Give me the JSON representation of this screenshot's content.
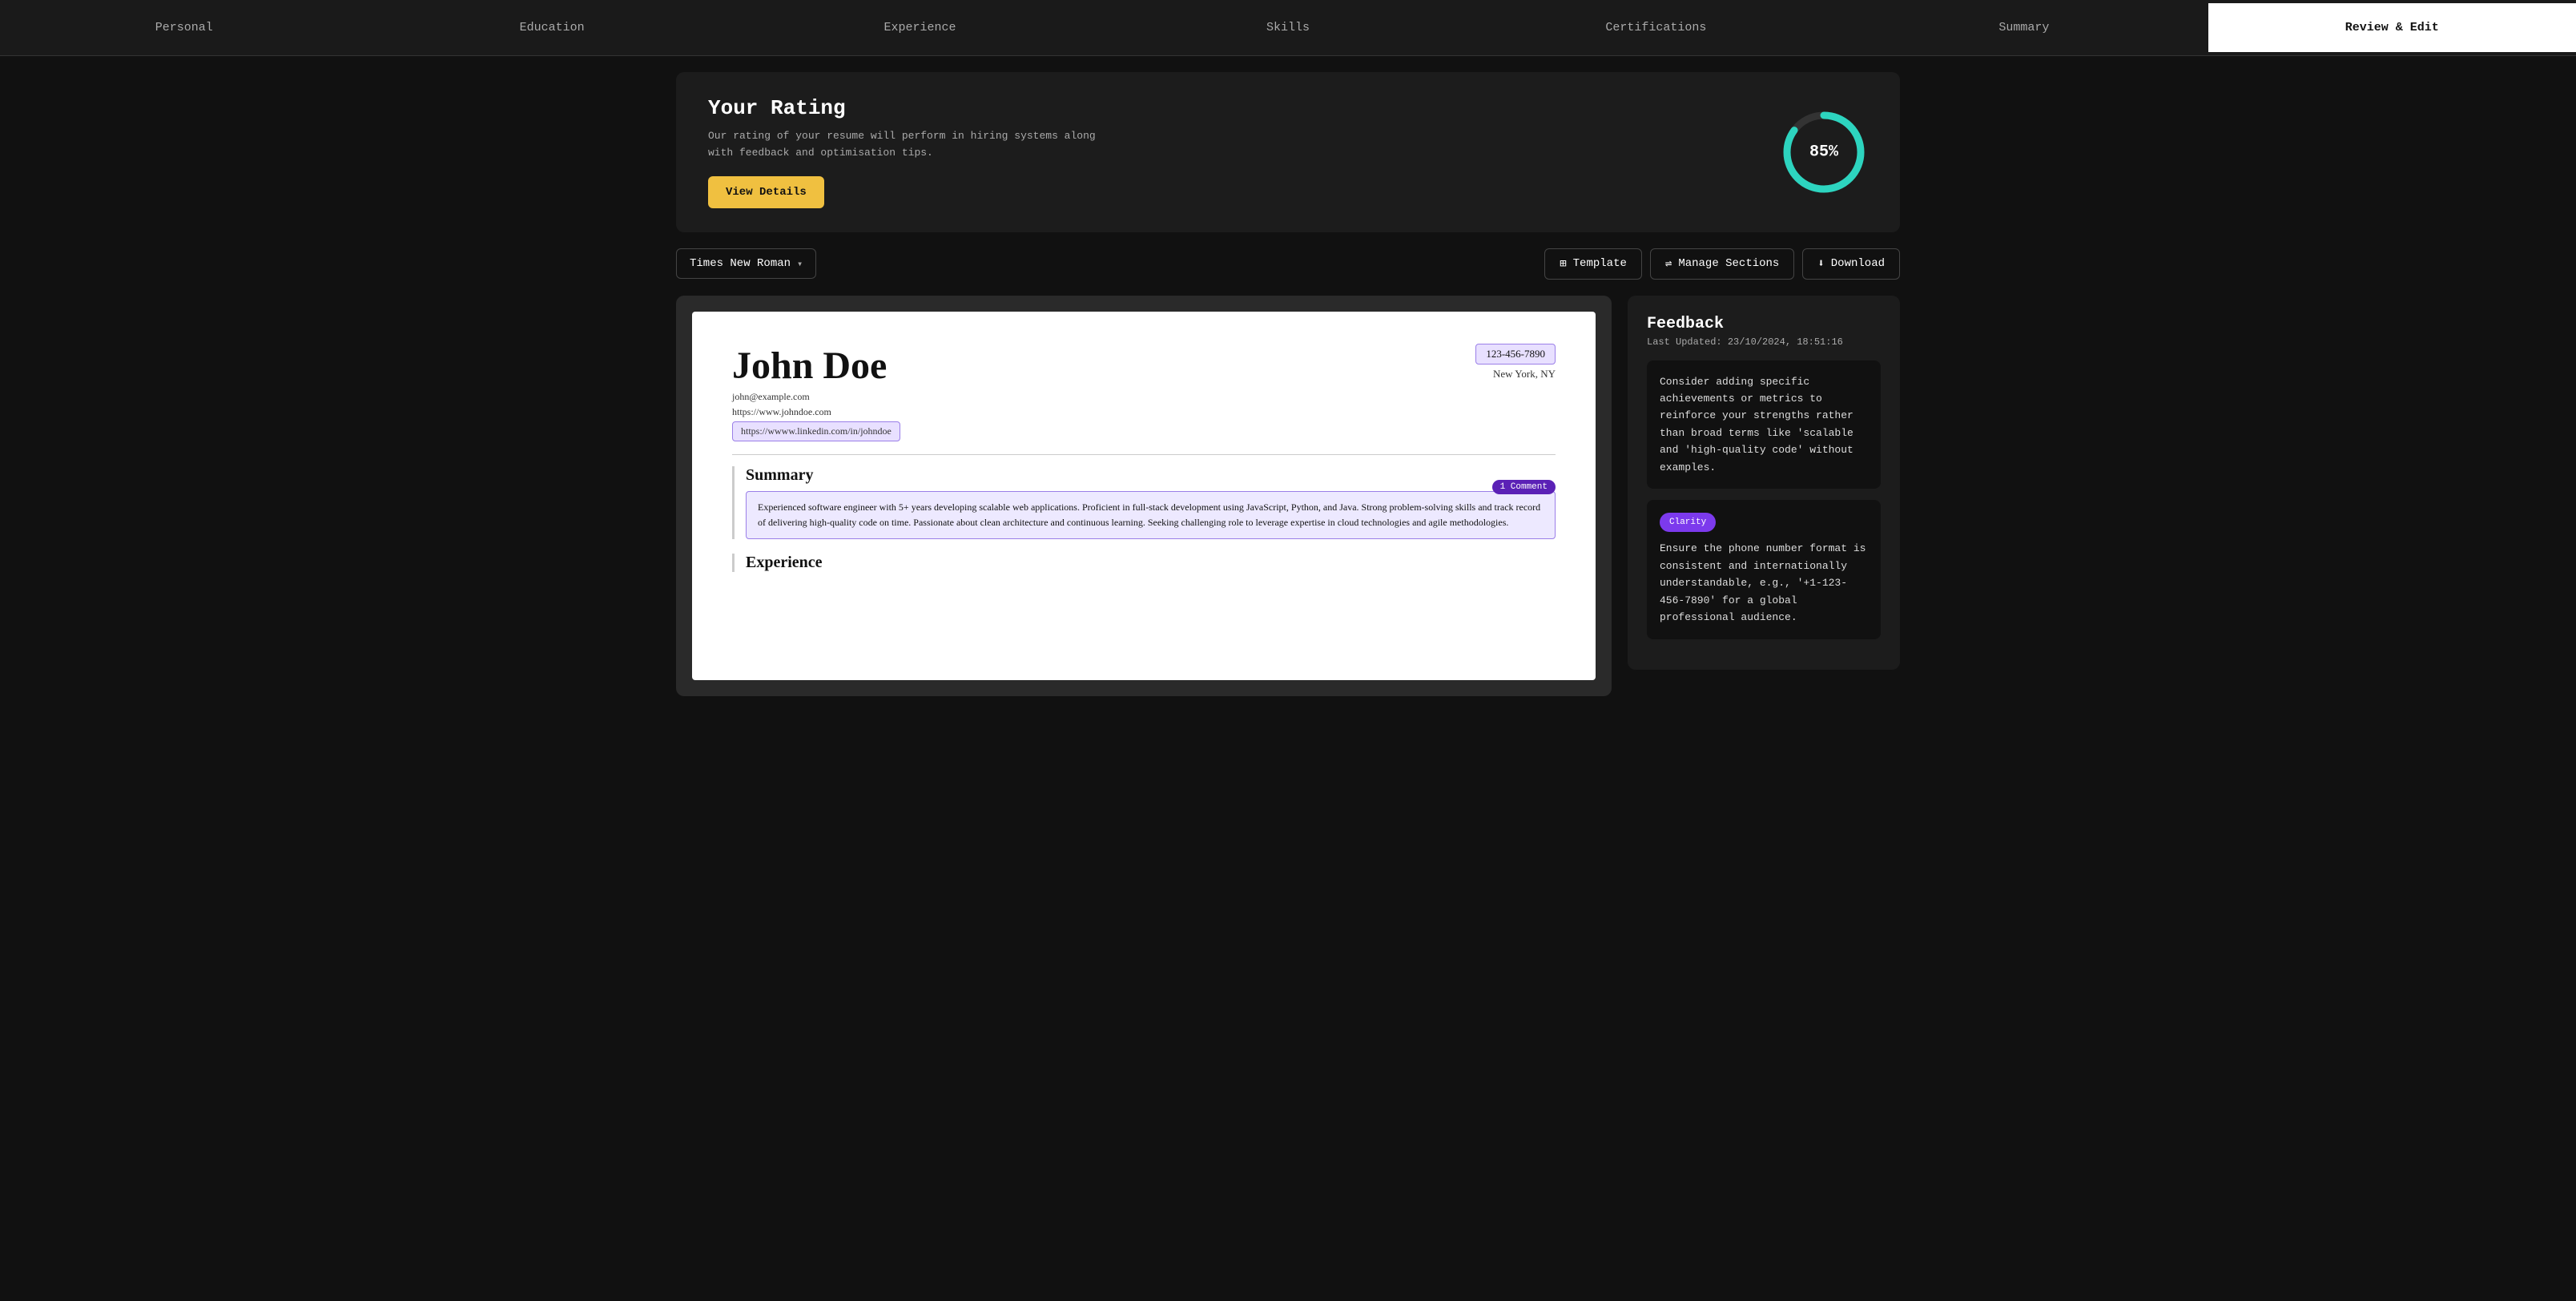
{
  "nav": {
    "items": [
      {
        "id": "personal",
        "label": "Personal",
        "active": false
      },
      {
        "id": "education",
        "label": "Education",
        "active": false
      },
      {
        "id": "experience",
        "label": "Experience",
        "active": false
      },
      {
        "id": "skills",
        "label": "Skills",
        "active": false
      },
      {
        "id": "certifications",
        "label": "Certifications",
        "active": false
      },
      {
        "id": "summary",
        "label": "Summary",
        "active": false
      },
      {
        "id": "review-edit",
        "label": "Review & Edit",
        "active": true
      }
    ]
  },
  "rating": {
    "title": "Your Rating",
    "description": "Our rating of your resume will perform in hiring systems along with feedback and optimisation tips.",
    "view_details_label": "View Details",
    "score": 85,
    "score_label": "85%"
  },
  "toolbar": {
    "font_selector_label": "Times New Roman",
    "template_label": "Template",
    "manage_sections_label": "Manage Sections",
    "download_label": "Download"
  },
  "resume": {
    "name": "John Doe",
    "phone": "123-456-7890",
    "location": "New York, NY",
    "email": "john@example.com",
    "website": "https://www.johndoe.com",
    "linkedin": "https://wwww.linkedin.com/in/johndoe",
    "sections": [
      {
        "id": "summary",
        "title": "Summary",
        "comment_badge": "1 Comment",
        "content": "Experienced software engineer with 5+ years developing scalable web applications. Proficient in full-stack development using JavaScript, Python, and Java. Strong problem-solving skills and track record of delivering high-quality code on time. Passionate about clean architecture and continuous learning. Seeking challenging role to leverage expertise in cloud technologies and agile methodologies."
      },
      {
        "id": "experience",
        "title": "Experience"
      }
    ]
  },
  "feedback": {
    "title": "Feedback",
    "last_updated": "Last Updated: 23/10/2024, 18:51:16",
    "items": [
      {
        "id": "feedback-1",
        "badge": null,
        "text": "Consider adding specific achievements or metrics to reinforce your strengths rather than broad terms like 'scalable and 'high-quality code' without examples."
      },
      {
        "id": "feedback-2",
        "badge": "Clarity",
        "text": "Ensure the phone number format is consistent and internationally understandable, e.g., '+1-123-456-7890' for a global professional audience."
      }
    ]
  }
}
